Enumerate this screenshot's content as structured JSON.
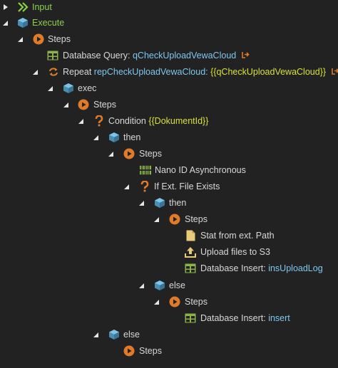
{
  "tree": {
    "input_label": "Input",
    "execute_label": "Execute",
    "steps_label": "Steps",
    "db_query_prefix": "Database Query:",
    "db_query_value": "qCheckUploadVewaCloud",
    "repeat_prefix": "Repeat",
    "repeat_value": "repCheckUploadVewaCloud:",
    "repeat_expr": "{{qCheckUploadVewaCloud}}",
    "exec_label": "exec",
    "exec_steps_label": "Steps",
    "condition_prefix": "Condition",
    "condition_expr": "{{DokumentId}}",
    "then_label": "then",
    "then_steps_label": "Steps",
    "nanoid_label": "Nano ID Asynchronous",
    "if_exists_label": "If Ext. File Exists",
    "inner_then_label": "then",
    "inner_then_steps_label": "Steps",
    "stat_label": "Stat from ext. Path",
    "upload_label": "Upload files to S3",
    "db_insert1_prefix": "Database Insert:",
    "db_insert1_value": "insUploadLog",
    "inner_else_label": "else",
    "inner_else_steps_label": "Steps",
    "db_insert2_prefix": "Database Insert:",
    "db_insert2_value": "insert",
    "outer_else_label": "else",
    "outer_else_steps_label": "Steps"
  },
  "icons": {
    "input": "double-chevron-icon",
    "execute": "cube-icon",
    "steps": "play-circle-icon",
    "database": "table-icon",
    "repeat": "repeat-icon",
    "condition": "question-icon",
    "nanoid": "barcode-icon",
    "file": "file-icon",
    "upload": "upload-icon",
    "exit": "exit-icon"
  },
  "colors": {
    "background": "#222222",
    "text": "#d8d8d8",
    "green": "#8ad14b",
    "value": "#7ec8f0",
    "expression": "#d9e03a",
    "orange": "#e07b2a",
    "cube": "#5aa9cf",
    "table": "#8bb34a",
    "file": "#e9c97a"
  }
}
